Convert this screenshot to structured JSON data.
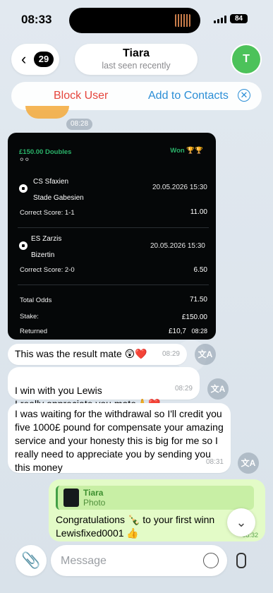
{
  "status_bar": {
    "time": "08:33",
    "battery": "84"
  },
  "header": {
    "unread_count": "29",
    "contact_name": "Tiara",
    "last_seen": "last seen recently",
    "avatar_letter": "T"
  },
  "action_bar": {
    "block_label": "Block User",
    "add_label": "Add to Contacts"
  },
  "date_chip": "08:28",
  "bet_slip": {
    "title": "£150.00 Doubles",
    "status": "Won 🏆🏆",
    "matches": [
      {
        "home": "CS Sfaxien",
        "away": "Stade Gabesien",
        "datetime": "20.05.2026 15:30",
        "market": "Correct Score: 1-1",
        "odds": "11.00"
      },
      {
        "home": "ES Zarzis",
        "away": "Bizertin",
        "datetime": "20.05.2026 15:30",
        "market": "Correct Score: 2-0",
        "odds": "6.50"
      }
    ],
    "total_odds_label": "Total Odds",
    "total_odds": "71.50",
    "stake_label": "Stake:",
    "stake": "£150.00",
    "returned_label": "Returned",
    "returned": "£10,7",
    "stamp": "08:28"
  },
  "messages": [
    {
      "text": "This was the result mate 😲❤️",
      "time": "08:29"
    },
    {
      "text": "I win with you Lewis\nI really appreciate you mate🙏❤️",
      "time": "08:29"
    },
    {
      "text": "I was waiting for the withdrawal so I'll credit you five 1000£ pound for compensate your amazing service and your honesty this is big for me so I really need to appreciate you by sending you this money",
      "time": "08:31"
    }
  ],
  "outgoing": {
    "reply_name": "Tiara",
    "reply_type": "Photo",
    "text": "Congratulations 🍾 to your first winn  Lewisfixed0001 👍",
    "time": "08:32"
  },
  "composer": {
    "placeholder": "Message"
  },
  "icons": {
    "translate": "translate-icon",
    "attach": "paperclip-icon",
    "mic": "microphone-icon",
    "sticker": "sticker-icon"
  }
}
